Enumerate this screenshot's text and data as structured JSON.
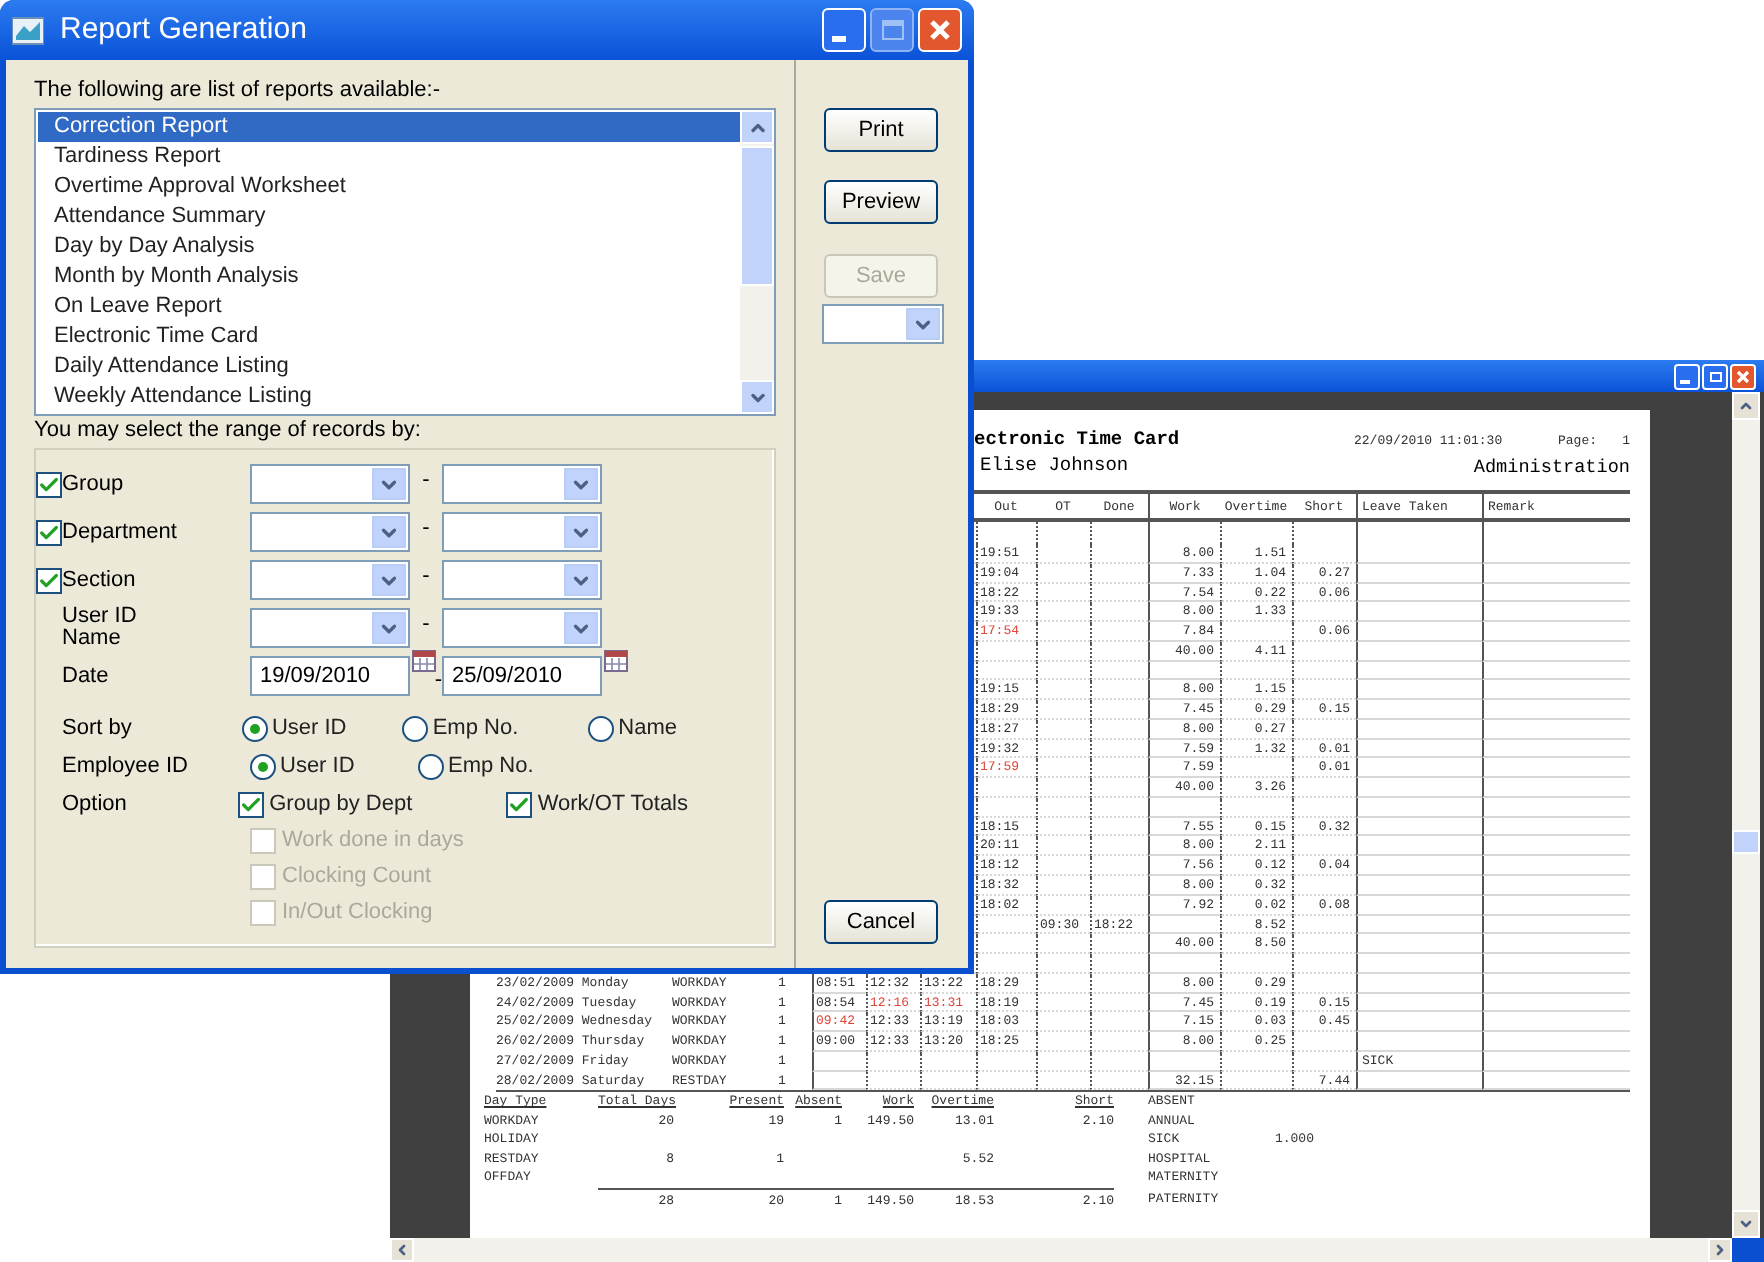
{
  "dialog": {
    "title": "Report Generation",
    "list_label": "The following are list of reports available:-",
    "reports": [
      {
        "label": "Correction Report",
        "selected": true
      },
      {
        "label": "Tardiness Report",
        "selected": false
      },
      {
        "label": "Overtime Approval Worksheet",
        "selected": false
      },
      {
        "label": "Attendance Summary",
        "selected": false
      },
      {
        "label": "Day by Day Analysis",
        "selected": false
      },
      {
        "label": "Month by Month Analysis",
        "selected": false
      },
      {
        "label": "On Leave Report",
        "selected": false
      },
      {
        "label": "Electronic Time Card",
        "selected": false
      },
      {
        "label": "Daily Attendance Listing",
        "selected": false
      },
      {
        "label": "Weekly Attendance Listing",
        "selected": false
      }
    ],
    "range_label": "You may select the range of records by:",
    "ranges": [
      {
        "kind": "combo",
        "label": "Group",
        "checked": true,
        "separator": "-"
      },
      {
        "kind": "combo",
        "label": "Department",
        "checked": true,
        "separator": "-"
      },
      {
        "kind": "combo",
        "label": "Section",
        "checked": true,
        "separator": "-"
      },
      {
        "kind": "combo",
        "label": "User ID Name",
        "separator": "-"
      },
      {
        "kind": "date",
        "label": "Date",
        "from": "19/09/2010",
        "to": "25/09/2010",
        "separator": "-"
      }
    ],
    "radio_groups": [
      {
        "label": "Sort by",
        "options": [
          {
            "label": "User ID",
            "selected": true
          },
          {
            "label": "Emp No.",
            "selected": false
          },
          {
            "label": "Name",
            "selected": false
          }
        ]
      },
      {
        "label": "Employee ID",
        "options": [
          {
            "label": "User ID",
            "selected": true
          },
          {
            "label": "Emp No.",
            "selected": false
          }
        ]
      }
    ],
    "option": {
      "label": "Option",
      "checks": [
        {
          "label": "Group by Dept",
          "checked": true,
          "disabled": false
        },
        {
          "label": "Work/OT Totals",
          "checked": true,
          "disabled": false
        },
        {
          "label": "Work done in days",
          "checked": false,
          "disabled": true
        },
        {
          "label": "Clocking Count",
          "checked": false,
          "disabled": true
        },
        {
          "label": "In/Out Clocking",
          "checked": false,
          "disabled": true
        }
      ]
    },
    "buttons": [
      {
        "label": "Print",
        "disabled": false
      },
      {
        "label": "Preview",
        "disabled": false
      },
      {
        "label": "Save",
        "disabled": true
      }
    ],
    "cancel": "Cancel"
  },
  "preview": {
    "report": {
      "title": "ectronic Time Card",
      "printed_at": "22/09/2010 11:01:30",
      "page_label": "Page:",
      "page_number": "1",
      "employee": "Elise Johnson",
      "department": "Administration",
      "columns": {
        "out": "Out",
        "ot": "OT",
        "done": "Done",
        "work": "Work",
        "overtime": "Overtime",
        "short": "Short",
        "leave_taken": "Leave Taken",
        "remark": "Remark"
      },
      "rows": [
        {
          "out": "19:51",
          "work": "8.00",
          "overtime": "1.51"
        },
        {
          "out": "19:04",
          "work": "7.33",
          "overtime": "1.04",
          "short": "0.27"
        },
        {
          "out": "18:22",
          "work": "7.54",
          "overtime": "0.22",
          "short": "0.06"
        },
        {
          "out": "19:33",
          "work": "8.00",
          "overtime": "1.33"
        },
        {
          "out": "17:54",
          "work": "7.84",
          "short": "0.06",
          "late": {
            "out": true
          }
        },
        {
          "work": "40.00",
          "overtime": "4.11"
        },
        {},
        {
          "out": "19:15",
          "work": "8.00",
          "overtime": "1.15"
        },
        {
          "out": "18:29",
          "work": "7.45",
          "overtime": "0.29",
          "short": "0.15"
        },
        {
          "out": "18:27",
          "work": "8.00",
          "overtime": "0.27"
        },
        {
          "out": "19:32",
          "work": "7.59",
          "overtime": "1.32",
          "short": "0.01"
        },
        {
          "out": "17:59",
          "work": "7.59",
          "short": "0.01",
          "late": {
            "out": true
          }
        },
        {
          "work": "40.00",
          "overtime": "3.26"
        },
        {},
        {
          "out": "18:15",
          "work": "7.55",
          "overtime": "0.15",
          "short": "0.32"
        },
        {
          "out": "20:11",
          "work": "8.00",
          "overtime": "2.11"
        },
        {
          "out": "18:12",
          "work": "7.56",
          "overtime": "0.12",
          "short": "0.04"
        },
        {
          "out": "18:32",
          "work": "8.00",
          "overtime": "0.32"
        },
        {
          "out": "18:02",
          "work": "7.92",
          "overtime": "0.02",
          "short": "0.08"
        },
        {
          "ot": "09:30",
          "done": "18:22",
          "overtime": "8.52"
        },
        {
          "work": "40.00",
          "overtime": "8.50"
        },
        {},
        {
          "date": "23/02/2009 Monday",
          "day_type": "WORKDAY",
          "days": "1",
          "in": "08:51",
          "break_out": "12:32",
          "break_in": "13:22",
          "out": "18:29",
          "work": "8.00",
          "overtime": "0.29"
        },
        {
          "date": "24/02/2009 Tuesday",
          "day_type": "WORKDAY",
          "days": "1",
          "in": "08:54",
          "break_out": "12:16",
          "break_in": "13:31",
          "out": "18:19",
          "work": "7.45",
          "overtime": "0.19",
          "short": "0.15",
          "late": {
            "break_out": true,
            "break_in": true
          }
        },
        {
          "date": "25/02/2009 Wednesday",
          "day_type": "WORKDAY",
          "days": "1",
          "in": "09:42",
          "break_out": "12:33",
          "break_in": "13:19",
          "out": "18:03",
          "work": "7.15",
          "overtime": "0.03",
          "short": "0.45",
          "late": {
            "in": true
          }
        },
        {
          "date": "26/02/2009 Thursday",
          "day_type": "WORKDAY",
          "days": "1",
          "in": "09:00",
          "break_out": "12:33",
          "break_in": "13:20",
          "out": "18:25",
          "work": "8.00",
          "overtime": "0.25"
        },
        {
          "date": "27/02/2009 Friday",
          "day_type": "WORKDAY",
          "days": "1",
          "leave_taken": "SICK"
        },
        {
          "date": "28/02/2009 Saturday",
          "day_type": "RESTDAY",
          "days": "1",
          "work": "32.15",
          "short": "7.44"
        }
      ],
      "summary": {
        "columns": {
          "day_type": "Day Type",
          "total_days": "Total Days",
          "present": "Present",
          "absent": "Absent",
          "work": "Work",
          "overtime": "Overtime",
          "short": "Short"
        },
        "rows": [
          {
            "day_type": "WORKDAY",
            "total_days": "20",
            "present": "19",
            "absent": "1",
            "work": "149.50",
            "overtime": "13.01",
            "short": "2.10"
          },
          {
            "day_type": "HOLIDAY"
          },
          {
            "day_type": "RESTDAY",
            "total_days": "8",
            "present": "1",
            "overtime": "5.52"
          },
          {
            "day_type": "OFFDAY"
          }
        ],
        "totals": {
          "total_days": "28",
          "present": "20",
          "absent": "1",
          "work": "149.50",
          "overtime": "18.53",
          "short": "2.10"
        }
      },
      "leave_types": [
        {
          "name": "ABSENT"
        },
        {
          "name": "ANNUAL"
        },
        {
          "name": "SICK",
          "value": "1.000"
        },
        {
          "name": "HOSPITAL"
        },
        {
          "name": "MATERNITY"
        },
        {
          "name": "PATERNITY"
        }
      ]
    }
  }
}
